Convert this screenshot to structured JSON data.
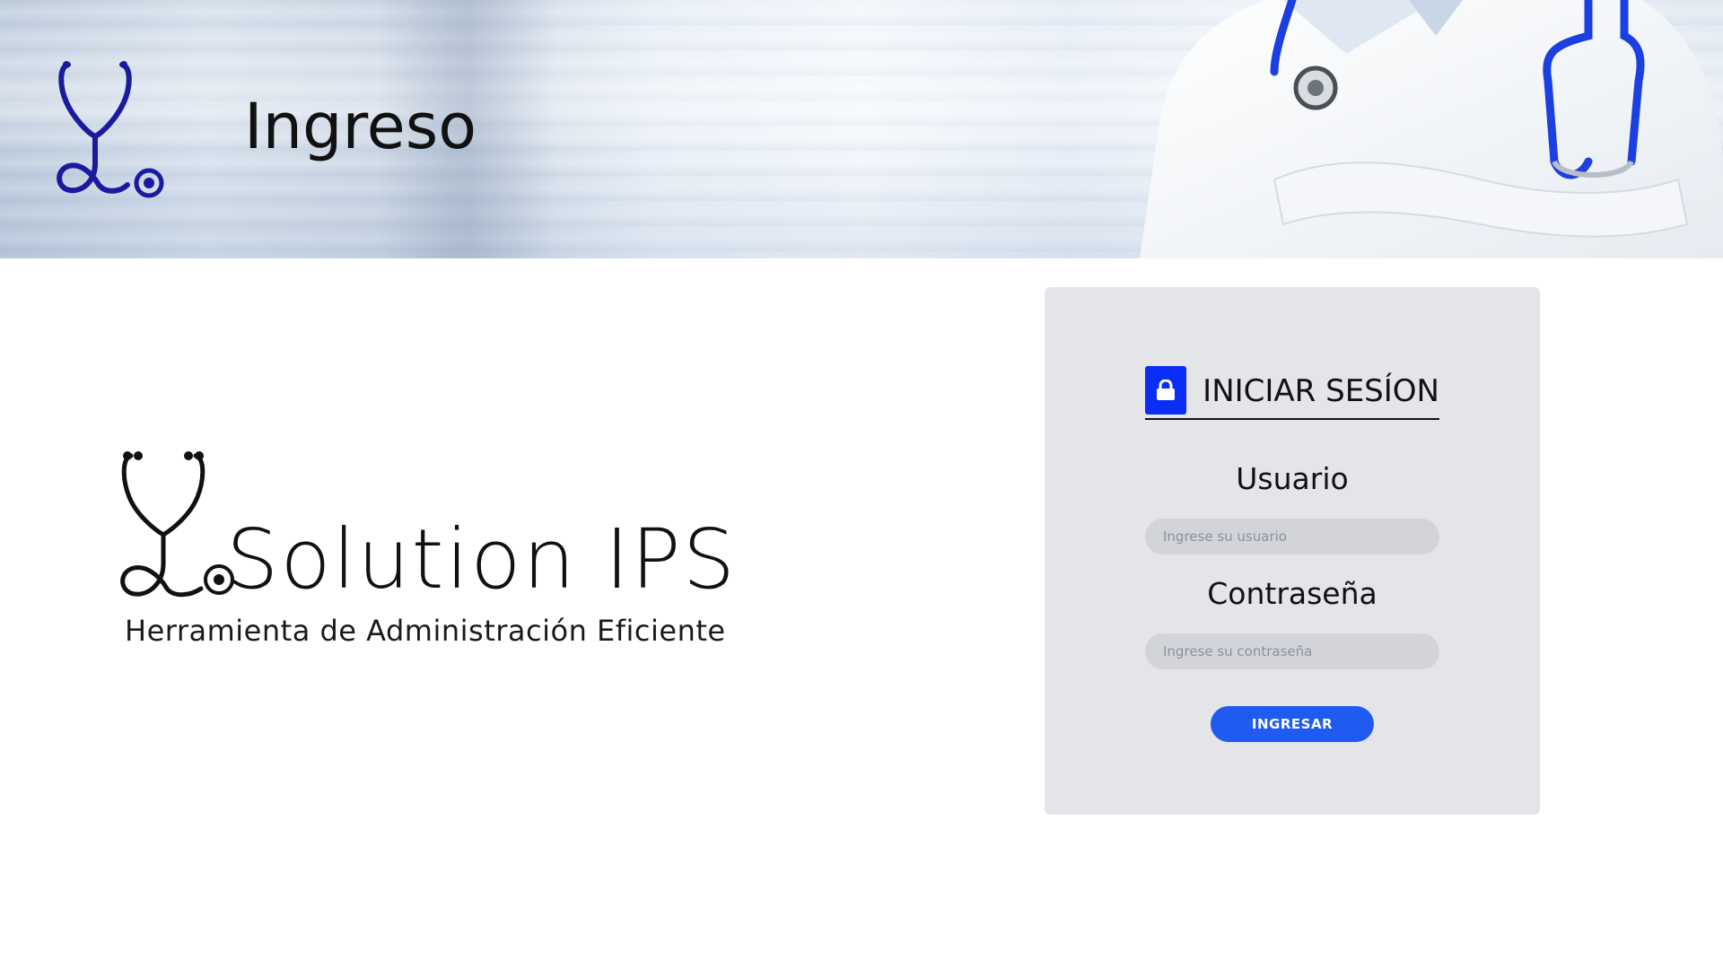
{
  "header": {
    "title": "Ingreso"
  },
  "brand": {
    "name": "Solution IPS",
    "tagline": "Herramienta de Administración Eficiente"
  },
  "login": {
    "title": "INICIAR SESÍON",
    "user_label": "Usuario",
    "user_placeholder": "Ingrese su usuario",
    "user_value": "",
    "password_label": "Contraseña",
    "password_placeholder": "Ingrese su contraseña",
    "password_value": "",
    "submit_label": "INGRESAR"
  },
  "icons": {
    "header_logo": "stethoscope-icon",
    "brand_logo": "stethoscope-icon",
    "lock": "lock-icon"
  },
  "colors": {
    "accent": "#0a2ef5",
    "button": "#1f5bf0",
    "card_bg": "#e4e5e9",
    "input_bg": "#d3d4da",
    "logo_blue": "#1a1a9e"
  }
}
